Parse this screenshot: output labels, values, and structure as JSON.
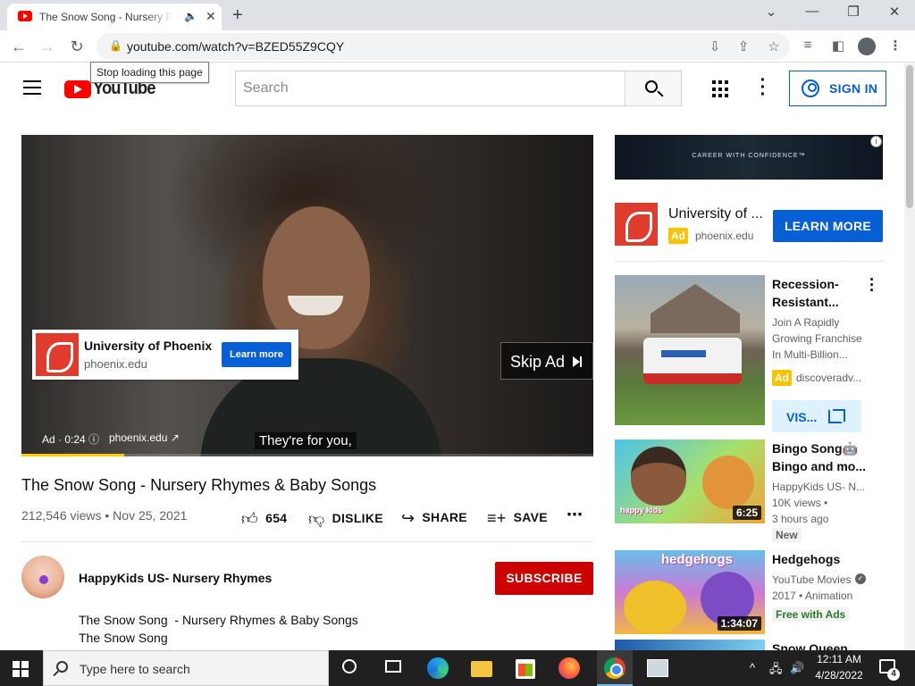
{
  "browser": {
    "tab_title": "The Snow Song - Nursery Rhymes & Baby Songs",
    "tab_audio_icon": "speaker-icon",
    "tab_close": "✕",
    "new_tab": "+",
    "url": "youtube.com/watch?v=BZED55Z9CQY",
    "tooltip": "Stop loading this page",
    "window_controls": [
      "chevron-down-icon",
      "minimize-icon",
      "restore-icon",
      "close-icon"
    ]
  },
  "youtube": {
    "logo_text": "YouTube",
    "search_placeholder": "Search",
    "signin_label": "SIGN IN",
    "accent": "#ff0000",
    "link_blue": "#065fd4"
  },
  "player": {
    "ad_card": {
      "title": "University of Phoenix",
      "domain": "phoenix.edu",
      "cta": "Learn more"
    },
    "skip_label": "Skip Ad",
    "ad_meta": "Ad · 0:24",
    "ad_domain": "phoenix.edu",
    "caption": "They're for you,",
    "progress_fraction": 0.18,
    "progress_color": "#ffcc00"
  },
  "video": {
    "title": "The Snow Song - Nursery Rhymes & Baby Songs",
    "meta": "212,546 views • Nov 25, 2021",
    "likes": "654",
    "dislike_label": "DISLIKE",
    "share_label": "SHARE",
    "save_label": "SAVE",
    "more": "⋯"
  },
  "channel": {
    "name": "HappyKids US- Nursery Rhymes",
    "subscribe_label": "SUBSCRIBE",
    "subscribe_color": "#cc0000"
  },
  "description": {
    "line1": "The Snow Song  - Nursery Rhymes & Baby Songs",
    "line2": "The Snow Song"
  },
  "sidebar": {
    "banner_text": "CAREER WITH CONFIDENCE™",
    "banner_info": "i",
    "ad": {
      "title": "University of ...",
      "badge": "Ad",
      "domain": "phoenix.edu",
      "cta": "LEARN MORE"
    },
    "recommendations": [
      {
        "title": "Recession-Resistant...",
        "desc": "Join A Rapidly Growing Franchise In Multi-Billion...",
        "badge": "Ad",
        "domain": "discoveradv...",
        "cta": "VIS..."
      },
      {
        "title": "Bingo Song🤖 Bingo and mo...",
        "channel": "HappyKids US- N...",
        "views": "10K views •",
        "ago": "3 hours ago",
        "tag": "New",
        "duration": "6:25",
        "thumb_label": "happy kids"
      },
      {
        "title": "Hedgehogs",
        "channel": "YouTube Movies",
        "meta": "2017 • Animation",
        "tag": "Free with Ads",
        "duration": "1:34:07",
        "thumb_label": "hedgehogs",
        "verified": "✓"
      },
      {
        "title": "Snow Queen"
      }
    ]
  },
  "taskbar": {
    "search_placeholder": "Type here to search",
    "time": "12:11 AM",
    "date": "4/28/2022",
    "notifications": "4",
    "tray_arrow": "^"
  }
}
